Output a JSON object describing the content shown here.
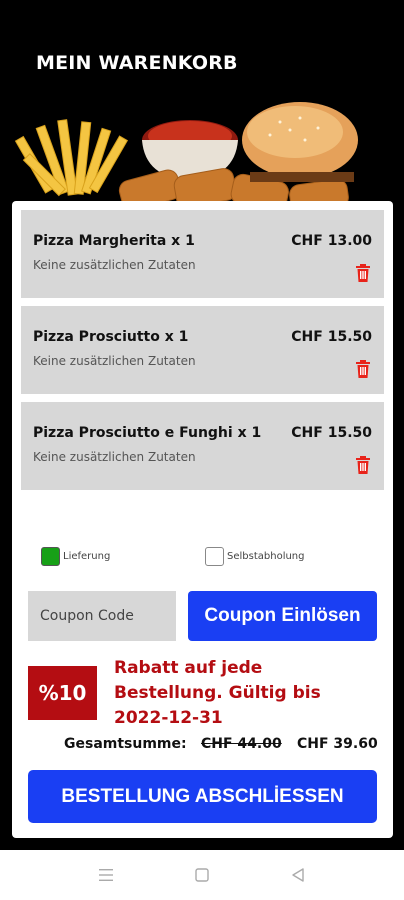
{
  "header": {
    "title": "MEIN WARENKORB"
  },
  "cart": {
    "items": [
      {
        "name": "Pizza Margherita x 1",
        "price": "CHF 13.00",
        "extras": "Keine zusätzlichen Zutaten"
      },
      {
        "name": "Pizza Prosciutto x 1",
        "price": "CHF 15.50",
        "extras": "Keine zusätzlichen Zutaten"
      },
      {
        "name": "Pizza Prosciutto e Funghi x 1",
        "price": "CHF 15.50",
        "extras": "Keine zusätzlichen Zutaten"
      }
    ]
  },
  "delivery": {
    "options": [
      {
        "label": "Lieferung",
        "checked": true
      },
      {
        "label": "Selbstabholung",
        "checked": false
      }
    ]
  },
  "coupon": {
    "placeholder": "Coupon Code",
    "button_label": "Coupon Einlösen"
  },
  "promo": {
    "badge": "%10",
    "text": "Rabatt auf jede Bestellung. Gültig bis 2022-12-31"
  },
  "totals": {
    "label": "Gesamtsumme:",
    "old_price": "CHF 44.00",
    "new_price": "CHF 39.60"
  },
  "order": {
    "button_label": "BESTELLUNG ABSCHLİESSEN"
  },
  "colors": {
    "accent_blue": "#1a3ff3",
    "promo_red": "#b40d12",
    "check_green": "#17a017",
    "trash_red": "#e8231a"
  },
  "icons": {
    "trash": "trash-icon",
    "nav_menu": "menu-icon",
    "nav_home": "square-home-icon",
    "nav_back": "back-triangle-icon"
  }
}
